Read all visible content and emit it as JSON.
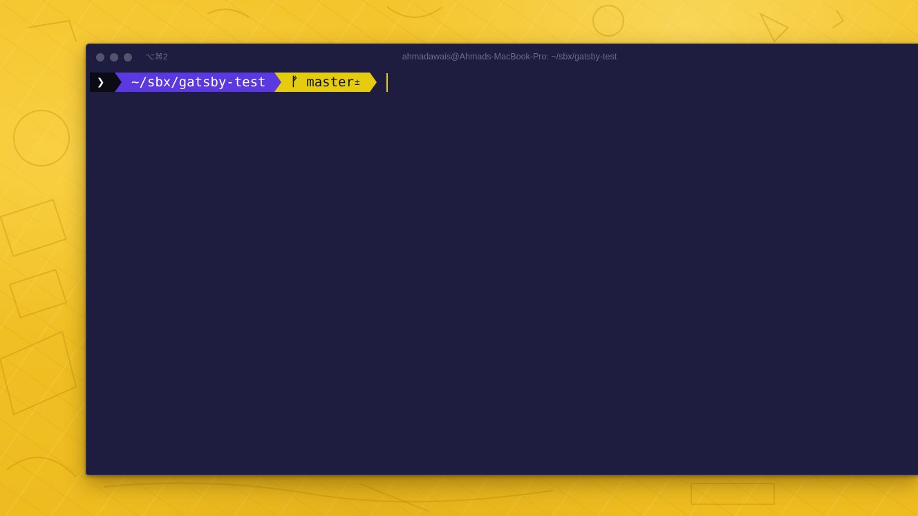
{
  "desktop": {
    "wallpaper_icon": "illustrated-doodle-wallpaper"
  },
  "window": {
    "title": "ahmadawais@Ahmads-MacBook-Pro: ~/sbx/gatsby-test",
    "shortcut": "⌥⌘2",
    "traffic_lights": [
      "close",
      "minimize",
      "zoom"
    ],
    "background_color": "#1f1d3f"
  },
  "prompt": {
    "symbol": "❯",
    "path": "~/sbx/gatsby-test",
    "branch_icon": "ᚠ",
    "branch": "master",
    "dirty_marker": "±",
    "colors": {
      "symbol_bg": "#0b0b15",
      "path_bg": "#5b39e0",
      "git_bg": "#e5cc0e",
      "cursor": "#e5cc0e"
    }
  }
}
